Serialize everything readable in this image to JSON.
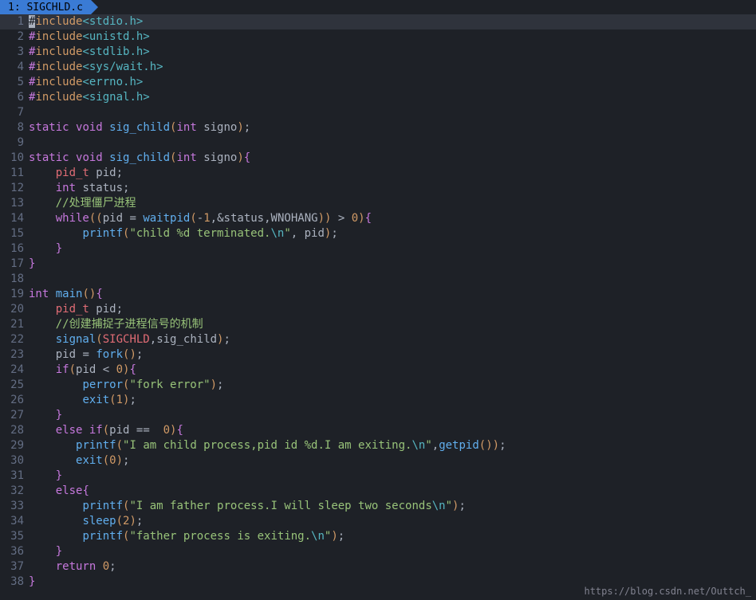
{
  "tab": {
    "label": "1: SIGCHLD.c"
  },
  "watermark": "https://blog.csdn.net/Outtch_",
  "lines": [
    {
      "n": 1,
      "current": true,
      "tokens": [
        [
          "cursor",
          "#"
        ],
        [
          "kw-inc",
          "include"
        ],
        [
          "hdr",
          "<stdio.h>"
        ]
      ]
    },
    {
      "n": 2,
      "tokens": [
        [
          "kw-pp",
          "#"
        ],
        [
          "kw-inc",
          "include"
        ],
        [
          "hdr",
          "<unistd.h>"
        ]
      ]
    },
    {
      "n": 3,
      "tokens": [
        [
          "kw-pp",
          "#"
        ],
        [
          "kw-inc",
          "include"
        ],
        [
          "hdr",
          "<stdlib.h>"
        ]
      ]
    },
    {
      "n": 4,
      "tokens": [
        [
          "kw-pp",
          "#"
        ],
        [
          "kw-inc",
          "include"
        ],
        [
          "hdr",
          "<sys/wait.h>"
        ]
      ]
    },
    {
      "n": 5,
      "tokens": [
        [
          "kw-pp",
          "#"
        ],
        [
          "kw-inc",
          "include"
        ],
        [
          "hdr",
          "<errno.h>"
        ]
      ]
    },
    {
      "n": 6,
      "tokens": [
        [
          "kw-pp",
          "#"
        ],
        [
          "kw-inc",
          "include"
        ],
        [
          "hdr",
          "<signal.h>"
        ]
      ]
    },
    {
      "n": 7,
      "tokens": []
    },
    {
      "n": 8,
      "tokens": [
        [
          "kw-type",
          "static"
        ],
        [
          "plain",
          " "
        ],
        [
          "kw-type",
          "void"
        ],
        [
          "plain",
          " "
        ],
        [
          "fn",
          "sig_child"
        ],
        [
          "paren",
          "("
        ],
        [
          "kw-type",
          "int"
        ],
        [
          "plain",
          " "
        ],
        [
          "plain",
          "signo"
        ],
        [
          "paren",
          ")"
        ],
        [
          "op",
          ";"
        ]
      ]
    },
    {
      "n": 9,
      "tokens": []
    },
    {
      "n": 10,
      "tokens": [
        [
          "kw-type",
          "static"
        ],
        [
          "plain",
          " "
        ],
        [
          "kw-type",
          "void"
        ],
        [
          "plain",
          " "
        ],
        [
          "fn",
          "sig_child"
        ],
        [
          "paren",
          "("
        ],
        [
          "kw-type",
          "int"
        ],
        [
          "plain",
          " "
        ],
        [
          "plain",
          "signo"
        ],
        [
          "paren",
          ")"
        ],
        [
          "brace",
          "{"
        ]
      ]
    },
    {
      "n": 11,
      "tokens": [
        [
          "plain",
          "    "
        ],
        [
          "id",
          "pid_t"
        ],
        [
          "plain",
          " pid"
        ],
        [
          "op",
          ";"
        ]
      ]
    },
    {
      "n": 12,
      "tokens": [
        [
          "plain",
          "    "
        ],
        [
          "kw-type",
          "int"
        ],
        [
          "plain",
          " status"
        ],
        [
          "op",
          ";"
        ]
      ]
    },
    {
      "n": 13,
      "tokens": [
        [
          "plain",
          "    "
        ],
        [
          "cmt-g",
          "//处理僵尸进程"
        ]
      ]
    },
    {
      "n": 14,
      "tokens": [
        [
          "plain",
          "    "
        ],
        [
          "kw-ctrl",
          "while"
        ],
        [
          "paren",
          "(("
        ],
        [
          "plain",
          "pid "
        ],
        [
          "op",
          "="
        ],
        [
          "plain",
          " "
        ],
        [
          "fn",
          "waitpid"
        ],
        [
          "paren",
          "("
        ],
        [
          "op",
          "-"
        ],
        [
          "num",
          "1"
        ],
        [
          "op",
          ","
        ],
        [
          "op",
          "&"
        ],
        [
          "plain",
          "status"
        ],
        [
          "op",
          ","
        ],
        [
          "plain",
          "WNOHANG"
        ],
        [
          "paren",
          "))"
        ],
        [
          "plain",
          " "
        ],
        [
          "op",
          ">"
        ],
        [
          "plain",
          " "
        ],
        [
          "num",
          "0"
        ],
        [
          "paren",
          ")"
        ],
        [
          "brace",
          "{"
        ]
      ]
    },
    {
      "n": 15,
      "tokens": [
        [
          "plain",
          "        "
        ],
        [
          "fn",
          "printf"
        ],
        [
          "paren",
          "("
        ],
        [
          "str",
          "\"child %d terminated."
        ],
        [
          "esc",
          "\\n"
        ],
        [
          "str",
          "\""
        ],
        [
          "op",
          ","
        ],
        [
          "plain",
          " pid"
        ],
        [
          "paren",
          ")"
        ],
        [
          "op",
          ";"
        ]
      ]
    },
    {
      "n": 16,
      "tokens": [
        [
          "plain",
          "    "
        ],
        [
          "brace",
          "}"
        ]
      ]
    },
    {
      "n": 17,
      "tokens": [
        [
          "brace",
          "}"
        ]
      ]
    },
    {
      "n": 18,
      "tokens": []
    },
    {
      "n": 19,
      "tokens": [
        [
          "kw-type",
          "int"
        ],
        [
          "plain",
          " "
        ],
        [
          "fn",
          "main"
        ],
        [
          "paren",
          "()"
        ],
        [
          "brace",
          "{"
        ]
      ]
    },
    {
      "n": 20,
      "tokens": [
        [
          "plain",
          "    "
        ],
        [
          "id",
          "pid_t"
        ],
        [
          "plain",
          " pid"
        ],
        [
          "op",
          ";"
        ]
      ]
    },
    {
      "n": 21,
      "tokens": [
        [
          "plain",
          "    "
        ],
        [
          "cmt-g",
          "//创建捕捉子进程信号的机制"
        ]
      ]
    },
    {
      "n": 22,
      "tokens": [
        [
          "plain",
          "    "
        ],
        [
          "fn",
          "signal"
        ],
        [
          "paren",
          "("
        ],
        [
          "id",
          "SIGCHLD"
        ],
        [
          "op",
          ","
        ],
        [
          "plain",
          "sig_child"
        ],
        [
          "paren",
          ")"
        ],
        [
          "op",
          ";"
        ]
      ]
    },
    {
      "n": 23,
      "tokens": [
        [
          "plain",
          "    "
        ],
        [
          "plain",
          "pid "
        ],
        [
          "op",
          "="
        ],
        [
          "plain",
          " "
        ],
        [
          "fn",
          "fork"
        ],
        [
          "paren",
          "()"
        ],
        [
          "op",
          ";"
        ]
      ]
    },
    {
      "n": 24,
      "tokens": [
        [
          "plain",
          "    "
        ],
        [
          "kw-ctrl",
          "if"
        ],
        [
          "paren",
          "("
        ],
        [
          "plain",
          "pid "
        ],
        [
          "op",
          "<"
        ],
        [
          "plain",
          " "
        ],
        [
          "num",
          "0"
        ],
        [
          "paren",
          ")"
        ],
        [
          "brace",
          "{"
        ]
      ]
    },
    {
      "n": 25,
      "tokens": [
        [
          "plain",
          "        "
        ],
        [
          "fn",
          "perror"
        ],
        [
          "paren",
          "("
        ],
        [
          "str",
          "\"fork error\""
        ],
        [
          "paren",
          ")"
        ],
        [
          "op",
          ";"
        ]
      ]
    },
    {
      "n": 26,
      "tokens": [
        [
          "plain",
          "        "
        ],
        [
          "fn",
          "exit"
        ],
        [
          "paren",
          "("
        ],
        [
          "num",
          "1"
        ],
        [
          "paren",
          ")"
        ],
        [
          "op",
          ";"
        ]
      ]
    },
    {
      "n": 27,
      "tokens": [
        [
          "plain",
          "    "
        ],
        [
          "brace",
          "}"
        ]
      ]
    },
    {
      "n": 28,
      "tokens": [
        [
          "plain",
          "    "
        ],
        [
          "kw-ctrl",
          "else"
        ],
        [
          "plain",
          " "
        ],
        [
          "kw-ctrl",
          "if"
        ],
        [
          "paren",
          "("
        ],
        [
          "plain",
          "pid "
        ],
        [
          "op",
          "=="
        ],
        [
          "plain",
          "  "
        ],
        [
          "num",
          "0"
        ],
        [
          "paren",
          ")"
        ],
        [
          "brace",
          "{"
        ]
      ]
    },
    {
      "n": 29,
      "tokens": [
        [
          "plain",
          "       "
        ],
        [
          "fn",
          "printf"
        ],
        [
          "paren",
          "("
        ],
        [
          "str",
          "\"I am child process,pid id %d.I am exiting."
        ],
        [
          "esc",
          "\\n"
        ],
        [
          "str",
          "\""
        ],
        [
          "op",
          ","
        ],
        [
          "fn",
          "getpid"
        ],
        [
          "paren",
          "()"
        ],
        [
          "paren",
          ")"
        ],
        [
          "op",
          ";"
        ]
      ]
    },
    {
      "n": 30,
      "tokens": [
        [
          "plain",
          "       "
        ],
        [
          "fn",
          "exit"
        ],
        [
          "paren",
          "("
        ],
        [
          "num",
          "0"
        ],
        [
          "paren",
          ")"
        ],
        [
          "op",
          ";"
        ]
      ]
    },
    {
      "n": 31,
      "tokens": [
        [
          "plain",
          "    "
        ],
        [
          "brace",
          "}"
        ]
      ]
    },
    {
      "n": 32,
      "tokens": [
        [
          "plain",
          "    "
        ],
        [
          "kw-ctrl",
          "else"
        ],
        [
          "brace",
          "{"
        ]
      ]
    },
    {
      "n": 33,
      "tokens": [
        [
          "plain",
          "        "
        ],
        [
          "fn",
          "printf"
        ],
        [
          "paren",
          "("
        ],
        [
          "str",
          "\"I am father process.I will sleep two seconds"
        ],
        [
          "esc",
          "\\n"
        ],
        [
          "str",
          "\""
        ],
        [
          "paren",
          ")"
        ],
        [
          "op",
          ";"
        ]
      ]
    },
    {
      "n": 34,
      "tokens": [
        [
          "plain",
          "        "
        ],
        [
          "fn",
          "sleep"
        ],
        [
          "paren",
          "("
        ],
        [
          "num",
          "2"
        ],
        [
          "paren",
          ")"
        ],
        [
          "op",
          ";"
        ]
      ]
    },
    {
      "n": 35,
      "tokens": [
        [
          "plain",
          "        "
        ],
        [
          "fn",
          "printf"
        ],
        [
          "paren",
          "("
        ],
        [
          "str",
          "\"father process is exiting."
        ],
        [
          "esc",
          "\\n"
        ],
        [
          "str",
          "\""
        ],
        [
          "paren",
          ")"
        ],
        [
          "op",
          ";"
        ]
      ]
    },
    {
      "n": 36,
      "tokens": [
        [
          "plain",
          "    "
        ],
        [
          "brace",
          "}"
        ]
      ]
    },
    {
      "n": 37,
      "tokens": [
        [
          "plain",
          "    "
        ],
        [
          "kw-ctrl",
          "return"
        ],
        [
          "plain",
          " "
        ],
        [
          "num",
          "0"
        ],
        [
          "op",
          ";"
        ]
      ]
    },
    {
      "n": 38,
      "tokens": [
        [
          "brace",
          "}"
        ]
      ]
    }
  ]
}
